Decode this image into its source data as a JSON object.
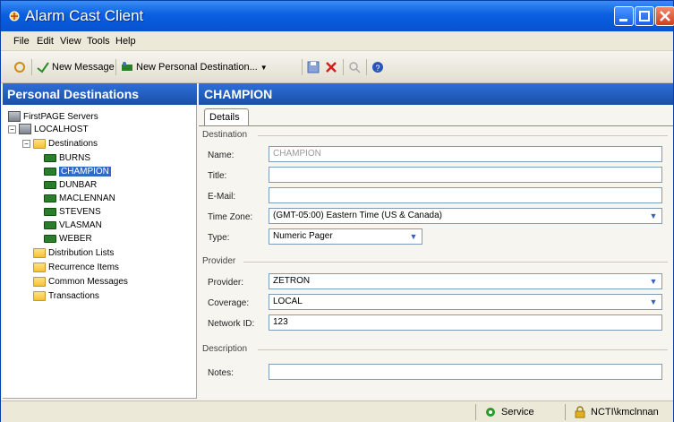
{
  "window": {
    "title": "Alarm Cast Client"
  },
  "menu": [
    "File",
    "Edit",
    "View",
    "Tools",
    "Help"
  ],
  "toolbar": {
    "new_message": "New Message",
    "new_personal_destination": "New Personal Destination..."
  },
  "left_pane": {
    "header": "Personal Destinations",
    "tree": {
      "root": "FirstPAGE Servers",
      "server": "LOCALHOST",
      "destinations_folder": "Destinations",
      "destinations": [
        "BURNS",
        "CHAMPION",
        "DUNBAR",
        "MACLENNAN",
        "STEVENS",
        "VLASMAN",
        "WEBER"
      ],
      "selected": "CHAMPION",
      "other_folders": [
        "Distribution Lists",
        "Recurrence Items",
        "Common Messages",
        "Transactions"
      ]
    }
  },
  "right_pane": {
    "header": "CHAMPION",
    "tab": "Details",
    "sections": {
      "destination": "Destination",
      "provider": "Provider",
      "description": "Description"
    },
    "fields": {
      "name": {
        "label": "Name:",
        "value": "CHAMPION"
      },
      "title": {
        "label": "Title:",
        "value": ""
      },
      "email": {
        "label": "E-Mail:",
        "value": ""
      },
      "time_zone": {
        "label": "Time Zone:",
        "value": "(GMT-05:00) Eastern Time (US & Canada)"
      },
      "type": {
        "label": "Type:",
        "value": "Numeric Pager"
      },
      "provider": {
        "label": "Provider:",
        "value": "ZETRON"
      },
      "coverage": {
        "label": "Coverage:",
        "value": "LOCAL"
      },
      "network_id": {
        "label": "Network ID:",
        "value": "123"
      },
      "notes": {
        "label": "Notes:",
        "value": ""
      }
    }
  },
  "status_bar": {
    "service": "Service",
    "user": "NCTI\\kmclnnan"
  },
  "colors": {
    "titlebar": "#0a5fe0",
    "pane_header": "#2d6fd8",
    "selection": "#316ac5"
  }
}
